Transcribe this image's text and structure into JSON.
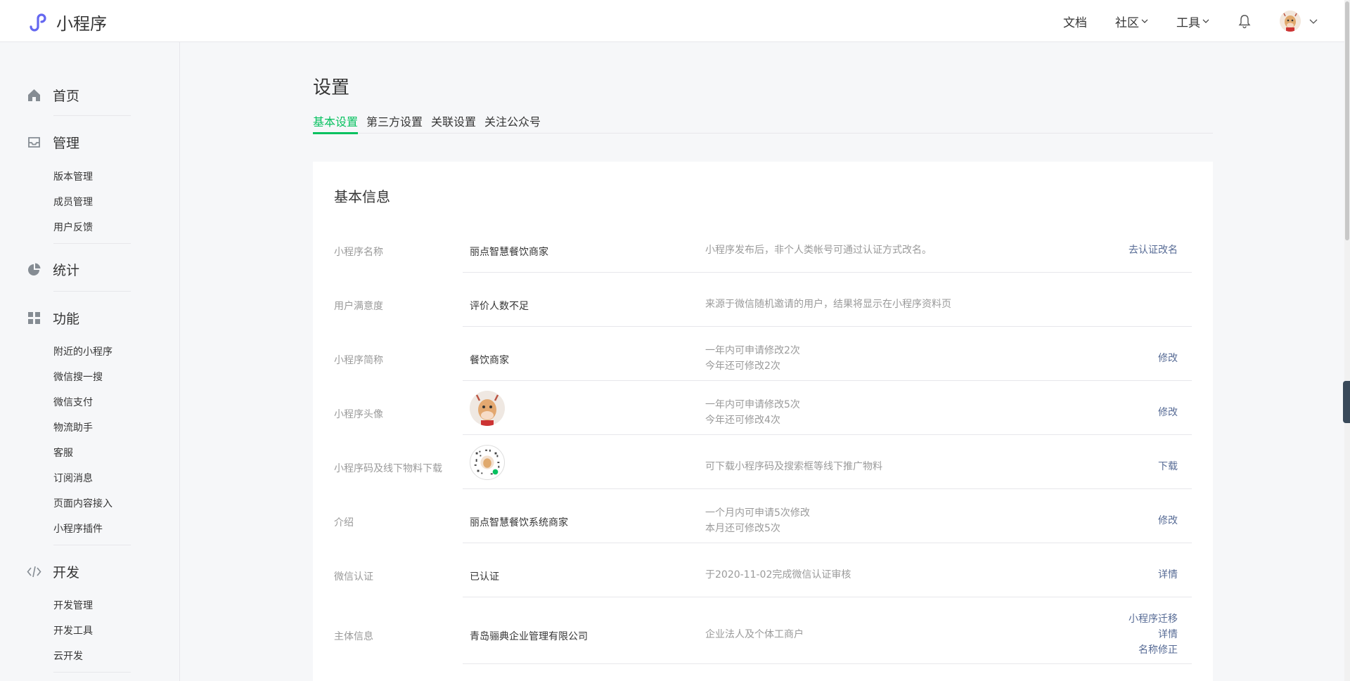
{
  "header": {
    "app_name": "小程序",
    "nav": [
      {
        "label": "文档",
        "has_dropdown": false
      },
      {
        "label": "社区",
        "has_dropdown": true
      },
      {
        "label": "工具",
        "has_dropdown": true
      }
    ],
    "icons": [
      "bell-icon",
      "avatar",
      "chevron-down-icon"
    ]
  },
  "sidebar": {
    "home": "首页",
    "manage": {
      "label": "管理",
      "items": [
        "版本管理",
        "成员管理",
        "用户反馈"
      ]
    },
    "stats": "统计",
    "features": {
      "label": "功能",
      "items": [
        "附近的小程序",
        "微信搜一搜",
        "微信支付",
        "物流助手",
        "客服",
        "订阅消息",
        "页面内容接入",
        "小程序插件"
      ]
    },
    "dev": {
      "label": "开发",
      "items": [
        "开发管理",
        "开发工具",
        "云开发"
      ]
    }
  },
  "page": {
    "title": "设置",
    "tabs": [
      "基本设置",
      "第三方设置",
      "关联设置",
      "关注公众号"
    ],
    "active_tab": 0
  },
  "basic_info": {
    "title": "基本信息",
    "rows": [
      {
        "label": "小程序名称",
        "value": "丽点智慧餐饮商家",
        "desc": [
          "小程序发布后，非个人类帐号可通过认证方式改名。"
        ],
        "actions": [
          "去认证改名"
        ]
      },
      {
        "label": "用户满意度",
        "value": "评价人数不足",
        "desc": [
          "来源于微信随机邀请的用户，结果将显示在小程序资料页"
        ],
        "actions": []
      },
      {
        "label": "小程序简称",
        "value": "餐饮商家",
        "desc": [
          "一年内可申请修改2次",
          "今年还可修改2次"
        ],
        "actions": [
          "修改"
        ]
      },
      {
        "label": "小程序头像",
        "value": "",
        "desc": [
          "一年内可申请修改5次",
          "今年还可修改4次"
        ],
        "actions": [
          "修改"
        ]
      },
      {
        "label": "小程序码及线下物料下载",
        "value": "",
        "desc": [
          "可下载小程序码及搜索框等线下推广物料"
        ],
        "actions": [
          "下载"
        ]
      },
      {
        "label": "介绍",
        "value": "丽点智慧餐饮系统商家",
        "desc": [
          "一个月内可申请5次修改",
          "本月还可修改5次"
        ],
        "actions": [
          "修改"
        ]
      },
      {
        "label": "微信认证",
        "value": "已认证",
        "desc": [
          "于2020-11-02完成微信认证审核"
        ],
        "actions": [
          "详情"
        ]
      },
      {
        "label": "主体信息",
        "value": "青岛骊典企业管理有限公司",
        "desc": [
          "企业法人及个体工商户"
        ],
        "actions": [
          "小程序迁移",
          "详情",
          "名称修正"
        ]
      }
    ]
  },
  "colors": {
    "accent": "#07c160",
    "link": "#576b95",
    "muted": "#9a9a9a",
    "text": "#353535"
  }
}
